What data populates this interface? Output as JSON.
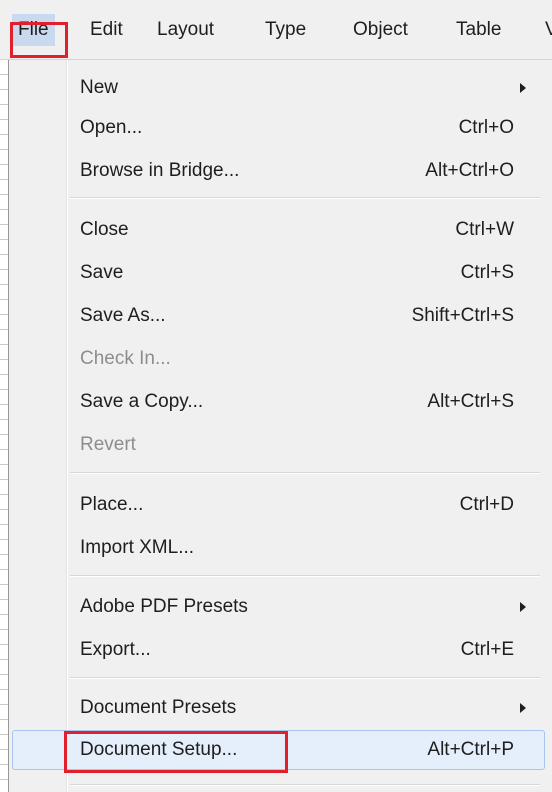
{
  "menubar": {
    "items": [
      {
        "label": "File"
      },
      {
        "label": "Edit"
      },
      {
        "label": "Layout"
      },
      {
        "label": "Type"
      },
      {
        "label": "Object"
      },
      {
        "label": "Table"
      },
      {
        "label": "V"
      }
    ]
  },
  "file_menu": {
    "items": [
      {
        "label": "New",
        "shortcut": "",
        "submenu": true,
        "disabled": false
      },
      {
        "label": "Open...",
        "shortcut": "Ctrl+O",
        "submenu": false,
        "disabled": false
      },
      {
        "label": "Browse in Bridge...",
        "shortcut": "Alt+Ctrl+O",
        "submenu": false,
        "disabled": false
      },
      {
        "label": "Close",
        "shortcut": "Ctrl+W",
        "submenu": false,
        "disabled": false
      },
      {
        "label": "Save",
        "shortcut": "Ctrl+S",
        "submenu": false,
        "disabled": false
      },
      {
        "label": "Save As...",
        "shortcut": "Shift+Ctrl+S",
        "submenu": false,
        "disabled": false
      },
      {
        "label": "Check In...",
        "shortcut": "",
        "submenu": false,
        "disabled": true
      },
      {
        "label": "Save a Copy...",
        "shortcut": "Alt+Ctrl+S",
        "submenu": false,
        "disabled": false
      },
      {
        "label": "Revert",
        "shortcut": "",
        "submenu": false,
        "disabled": true
      },
      {
        "label": "Place...",
        "shortcut": "Ctrl+D",
        "submenu": false,
        "disabled": false
      },
      {
        "label": "Import XML...",
        "shortcut": "",
        "submenu": false,
        "disabled": false
      },
      {
        "label": "Adobe PDF Presets",
        "shortcut": "",
        "submenu": true,
        "disabled": false
      },
      {
        "label": "Export...",
        "shortcut": "Ctrl+E",
        "submenu": false,
        "disabled": false
      },
      {
        "label": "Document Presets",
        "shortcut": "",
        "submenu": true,
        "disabled": false
      },
      {
        "label": "Document Setup...",
        "shortcut": "Alt+Ctrl+P",
        "submenu": false,
        "disabled": false,
        "highlighted": true
      }
    ]
  },
  "colors": {
    "highlight_box": "#e0202a",
    "hover_fill": "#e5eefb",
    "hover_border": "#a8c6ee",
    "disabled_text": "#8d8d8d"
  }
}
